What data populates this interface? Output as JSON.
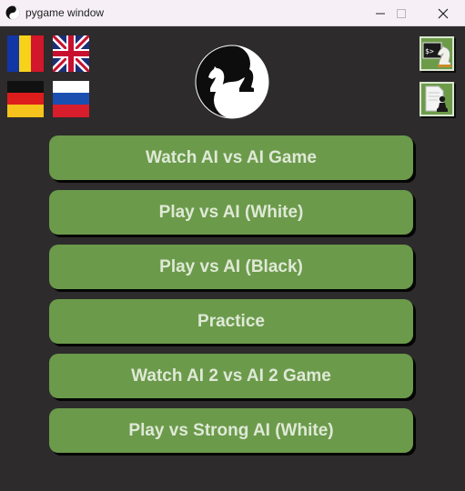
{
  "window": {
    "title": "pygame window"
  },
  "flags": [
    "Romania",
    "United Kingdom",
    "Germany",
    "Russia"
  ],
  "icons": [
    "console-knight-icon",
    "document-pawn-icon",
    "yin-yang-knights-logo"
  ],
  "menu": {
    "buttons": [
      "Watch AI vs AI Game",
      "Play vs AI (White)",
      "Play vs AI (Black)",
      "Practice",
      "Watch AI 2 vs AI 2 Game",
      "Play vs Strong AI (White)"
    ]
  },
  "colors": {
    "background": "#2d2b2b",
    "button": "#6b9a4b",
    "button_text": "#dfe9d6"
  }
}
